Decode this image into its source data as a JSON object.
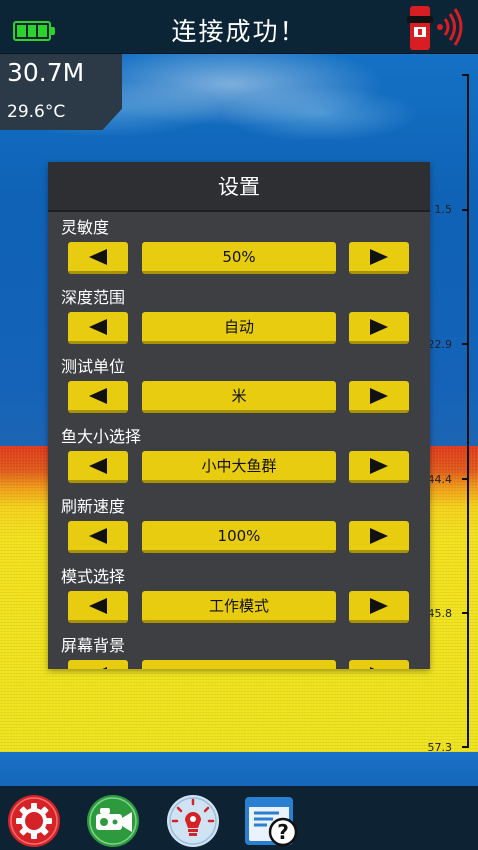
{
  "header": {
    "title": "连接成功！",
    "battery_icon": "battery-full-icon",
    "device_icon": "sonar-device-signal-icon"
  },
  "readout": {
    "depth": "30.7M",
    "temperature": "29.6°C"
  },
  "scale": {
    "labels": [
      "1.5",
      "22.9",
      "44.4",
      "45.8",
      "57.3"
    ]
  },
  "settings": {
    "title": "设置",
    "items": [
      {
        "label": "灵敏度",
        "value": "50%"
      },
      {
        "label": "深度范围",
        "value": "自动"
      },
      {
        "label": "测试单位",
        "value": "米"
      },
      {
        "label": "鱼大小选择",
        "value": "小中大鱼群"
      },
      {
        "label": "刷新速度",
        "value": "100%"
      },
      {
        "label": "模式选择",
        "value": "工作模式"
      },
      {
        "label": "屏幕背景",
        "value": ""
      }
    ]
  },
  "toolbar": {
    "icons": [
      "settings-gear-icon",
      "camera-icon",
      "light-bulb-icon",
      "help-document-icon"
    ]
  },
  "colors": {
    "accent": "#e8cc10",
    "battery": "#2fd12f",
    "dialog": "#3d3f43",
    "header": "#0b2436"
  }
}
